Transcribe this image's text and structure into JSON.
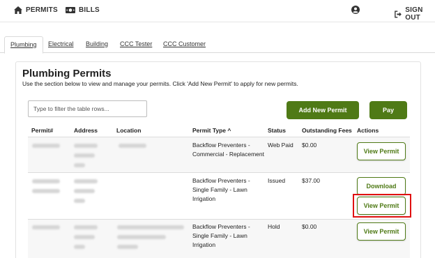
{
  "nav": {
    "permits_label": "PERMITS",
    "bills_label": "BILLS",
    "signout_label": "SIGN OUT"
  },
  "tabs": [
    "Plumbing",
    "Electrical",
    "Building",
    "CCC Tester",
    "CCC Customer"
  ],
  "panel": {
    "title": "Plumbing Permits",
    "subtitle": "Use the section below to view and manage your permits. Click 'Add New Permit' to apply for new permits."
  },
  "filter": {
    "placeholder": "Type to filter the table rows..."
  },
  "buttons": {
    "add_new_permit": "Add New Permit",
    "pay": "Pay"
  },
  "table": {
    "headers": [
      "Permit#",
      "Address",
      "Location",
      "Permit Type ^",
      "Status",
      "Outstanding Fees",
      "Actions"
    ],
    "rows": [
      {
        "permit_type": [
          "Backflow Preventers -",
          "Commercial - Replacement"
        ],
        "status": "Web Paid",
        "fees": "$0.00",
        "actions": [
          "View Permit"
        ]
      },
      {
        "permit_type": [
          "Backflow Preventers -",
          "Single Family - Lawn",
          "Irrigation"
        ],
        "status": "Issued",
        "fees": "$37.00",
        "actions": [
          "Download",
          "View Permit"
        ]
      },
      {
        "permit_type": [
          "Backflow Preventers -",
          "Single Family - Lawn",
          "Irrigation"
        ],
        "status": "Hold",
        "fees": "$0.00",
        "actions": [
          "View Permit"
        ]
      }
    ]
  },
  "colors": {
    "accent_green": "#4f7a16",
    "highlight_red": "#e01010"
  }
}
